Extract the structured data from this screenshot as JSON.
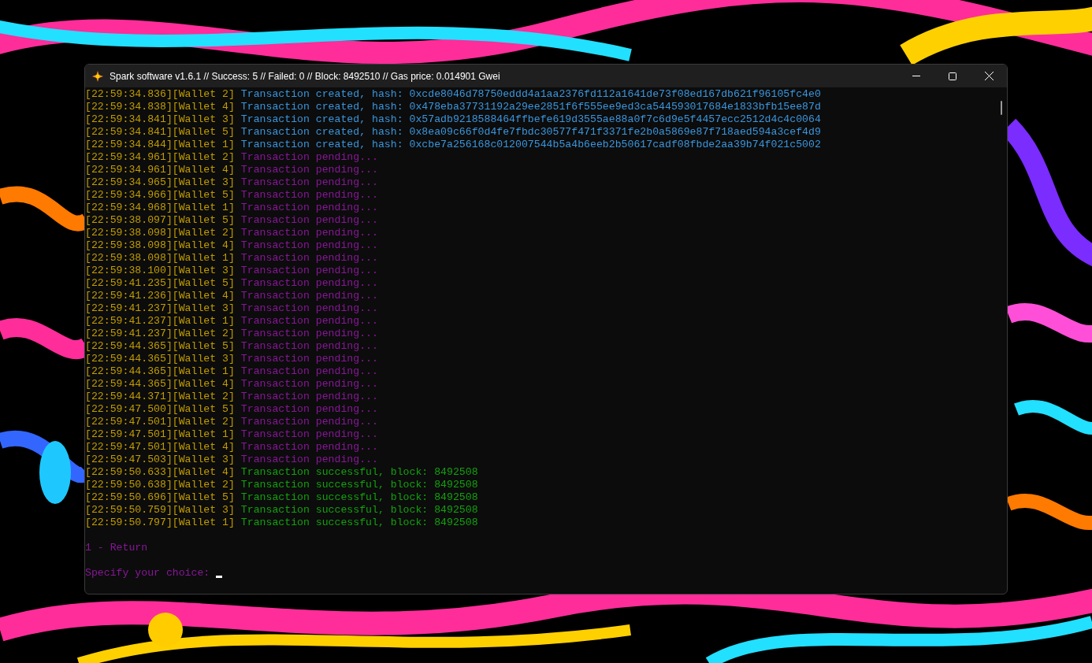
{
  "window": {
    "title": "Spark software v1.6.1 // Success: 5 // Failed: 0 // Block: 8492510 // Gas price: 0.014901 Gwei"
  },
  "log": [
    {
      "prefix": "[22:59:34.836][Wallet 2]",
      "kind": "created",
      "message": "Transaction created, hash: 0xcde8046d78750eddd4a1aa2376fd112a1641de73f08ed167db621f96105fc4e0"
    },
    {
      "prefix": "[22:59:34.838][Wallet 4]",
      "kind": "created",
      "message": "Transaction created, hash: 0x478eba37731192a29ee2851f6f555ee9ed3ca544593017684e1833bfb15ee87d"
    },
    {
      "prefix": "[22:59:34.841][Wallet 3]",
      "kind": "created",
      "message": "Transaction created, hash: 0x57adb9218588464ffbefe619d3555ae88a0f7c6d9e5f4457ecc2512d4c4c0064"
    },
    {
      "prefix": "[22:59:34.841][Wallet 5]",
      "kind": "created",
      "message": "Transaction created, hash: 0x8ea09c66f0d4fe7fbdc30577f471f3371fe2b0a5869e87f718aed594a3cef4d9"
    },
    {
      "prefix": "[22:59:34.844][Wallet 1]",
      "kind": "created",
      "message": "Transaction created, hash: 0xcbe7a256168c012007544b5a4b6eeb2b50617cadf08fbde2aa39b74f021c5002"
    },
    {
      "prefix": "[22:59:34.961][Wallet 2]",
      "kind": "pending",
      "message": "Transaction pending..."
    },
    {
      "prefix": "[22:59:34.961][Wallet 4]",
      "kind": "pending",
      "message": "Transaction pending..."
    },
    {
      "prefix": "[22:59:34.965][Wallet 3]",
      "kind": "pending",
      "message": "Transaction pending..."
    },
    {
      "prefix": "[22:59:34.966][Wallet 5]",
      "kind": "pending",
      "message": "Transaction pending..."
    },
    {
      "prefix": "[22:59:34.968][Wallet 1]",
      "kind": "pending",
      "message": "Transaction pending..."
    },
    {
      "prefix": "[22:59:38.097][Wallet 5]",
      "kind": "pending",
      "message": "Transaction pending..."
    },
    {
      "prefix": "[22:59:38.098][Wallet 2]",
      "kind": "pending",
      "message": "Transaction pending..."
    },
    {
      "prefix": "[22:59:38.098][Wallet 4]",
      "kind": "pending",
      "message": "Transaction pending..."
    },
    {
      "prefix": "[22:59:38.098][Wallet 1]",
      "kind": "pending",
      "message": "Transaction pending..."
    },
    {
      "prefix": "[22:59:38.100][Wallet 3]",
      "kind": "pending",
      "message": "Transaction pending..."
    },
    {
      "prefix": "[22:59:41.235][Wallet 5]",
      "kind": "pending",
      "message": "Transaction pending..."
    },
    {
      "prefix": "[22:59:41.236][Wallet 4]",
      "kind": "pending",
      "message": "Transaction pending..."
    },
    {
      "prefix": "[22:59:41.237][Wallet 3]",
      "kind": "pending",
      "message": "Transaction pending..."
    },
    {
      "prefix": "[22:59:41.237][Wallet 1]",
      "kind": "pending",
      "message": "Transaction pending..."
    },
    {
      "prefix": "[22:59:41.237][Wallet 2]",
      "kind": "pending",
      "message": "Transaction pending..."
    },
    {
      "prefix": "[22:59:44.365][Wallet 5]",
      "kind": "pending",
      "message": "Transaction pending..."
    },
    {
      "prefix": "[22:59:44.365][Wallet 3]",
      "kind": "pending",
      "message": "Transaction pending..."
    },
    {
      "prefix": "[22:59:44.365][Wallet 1]",
      "kind": "pending",
      "message": "Transaction pending..."
    },
    {
      "prefix": "[22:59:44.365][Wallet 4]",
      "kind": "pending",
      "message": "Transaction pending..."
    },
    {
      "prefix": "[22:59:44.371][Wallet 2]",
      "kind": "pending",
      "message": "Transaction pending..."
    },
    {
      "prefix": "[22:59:47.500][Wallet 5]",
      "kind": "pending",
      "message": "Transaction pending..."
    },
    {
      "prefix": "[22:59:47.501][Wallet 2]",
      "kind": "pending",
      "message": "Transaction pending..."
    },
    {
      "prefix": "[22:59:47.501][Wallet 1]",
      "kind": "pending",
      "message": "Transaction pending..."
    },
    {
      "prefix": "[22:59:47.501][Wallet 4]",
      "kind": "pending",
      "message": "Transaction pending..."
    },
    {
      "prefix": "[22:59:47.503][Wallet 3]",
      "kind": "pending",
      "message": "Transaction pending..."
    },
    {
      "prefix": "[22:59:50.633][Wallet 4]",
      "kind": "success",
      "message": "Transaction successful, block: 8492508"
    },
    {
      "prefix": "[22:59:50.638][Wallet 2]",
      "kind": "success",
      "message": "Transaction successful, block: 8492508"
    },
    {
      "prefix": "[22:59:50.696][Wallet 5]",
      "kind": "success",
      "message": "Transaction successful, block: 8492508"
    },
    {
      "prefix": "[22:59:50.759][Wallet 3]",
      "kind": "success",
      "message": "Transaction successful, block: 8492508"
    },
    {
      "prefix": "[22:59:50.797][Wallet 1]",
      "kind": "success",
      "message": "Transaction successful, block: 8492508"
    }
  ],
  "menu": [
    "1 - Return"
  ],
  "prompt": {
    "text": "Specify your choice:"
  }
}
